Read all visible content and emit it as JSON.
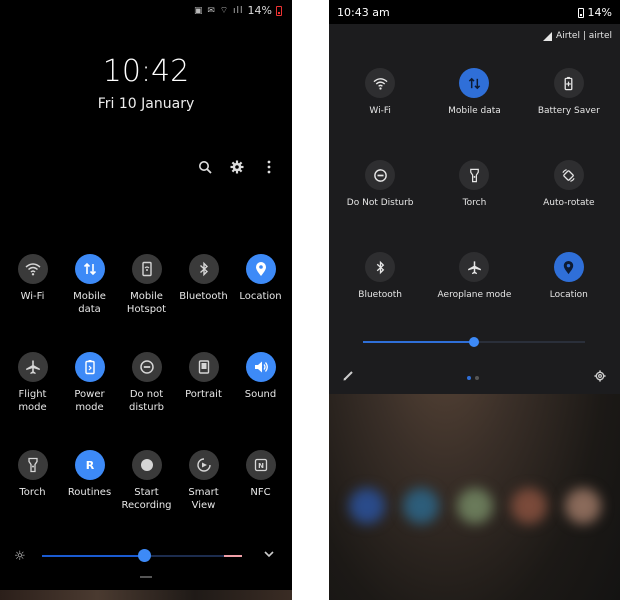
{
  "left": {
    "status": {
      "signal_icons": "▣ ✉ ⌔ ıll",
      "battery": "14%"
    },
    "clock": "10:42",
    "date": "Fri 10 January",
    "tiles": [
      [
        {
          "name": "wifi",
          "icon": "wifi-icon",
          "label": "Wi-Fi",
          "on": false
        },
        {
          "name": "mobile-data",
          "icon": "data-arrows-icon",
          "label": "Mobile\ndata",
          "on": true
        },
        {
          "name": "mobile-hotspot",
          "icon": "hotspot-icon",
          "label": "Mobile\nHotspot",
          "on": false
        },
        {
          "name": "bluetooth",
          "icon": "bluetooth-icon",
          "label": "Bluetooth",
          "on": false
        },
        {
          "name": "location",
          "icon": "location-pin-icon",
          "label": "Location",
          "on": true
        }
      ],
      [
        {
          "name": "flight-mode",
          "icon": "airplane-icon",
          "label": "Flight\nmode",
          "on": false
        },
        {
          "name": "power-mode",
          "icon": "power-mode-icon",
          "label": "Power\nmode",
          "on": true
        },
        {
          "name": "do-not-disturb",
          "icon": "minus-circle-icon",
          "label": "Do not\ndisturb",
          "on": false
        },
        {
          "name": "portrait",
          "icon": "portrait-icon",
          "label": "Portrait",
          "on": false
        },
        {
          "name": "sound",
          "icon": "speaker-icon",
          "label": "Sound",
          "on": true
        }
      ],
      [
        {
          "name": "torch",
          "icon": "torch-icon",
          "label": "Torch",
          "on": false
        },
        {
          "name": "routines",
          "icon": "routines-icon",
          "label": "Routines",
          "on": true
        },
        {
          "name": "start-recording",
          "icon": "record-icon",
          "label": "Start\nRecording",
          "on": false
        },
        {
          "name": "smart-view",
          "icon": "smart-view-icon",
          "label": "Smart\nView",
          "on": false
        },
        {
          "name": "nfc",
          "icon": "nfc-icon",
          "label": "NFC",
          "on": false
        }
      ]
    ],
    "brightness": 0.51,
    "colors": {
      "accent": "#3d8af7",
      "tile_off": "#3a3a3a",
      "background": "#000000"
    }
  },
  "right": {
    "time": "10:43 am",
    "battery": "14%",
    "carrier": "Airtel | airtel",
    "tiles": [
      [
        {
          "name": "wifi",
          "icon": "wifi-icon",
          "label": "Wi-Fi",
          "on": false
        },
        {
          "name": "mobile-data",
          "icon": "data-arrows-icon",
          "label": "Mobile data",
          "on": true
        },
        {
          "name": "battery-saver",
          "icon": "battery-saver-icon",
          "label": "Battery Saver",
          "on": false
        }
      ],
      [
        {
          "name": "do-not-disturb",
          "icon": "minus-circle-icon",
          "label": "Do Not Disturb",
          "on": false
        },
        {
          "name": "torch",
          "icon": "torch-icon",
          "label": "Torch",
          "on": false
        },
        {
          "name": "auto-rotate",
          "icon": "rotate-icon",
          "label": "Auto-rotate",
          "on": false
        }
      ],
      [
        {
          "name": "bluetooth",
          "icon": "bluetooth-icon",
          "label": "Bluetooth",
          "on": false
        },
        {
          "name": "aeroplane-mode",
          "icon": "airplane-icon",
          "label": "Aeroplane mode",
          "on": false
        },
        {
          "name": "location",
          "icon": "location-pin-icon",
          "label": "Location",
          "on": true
        }
      ]
    ],
    "brightness": 0.5,
    "page_dots": 2,
    "colors": {
      "accent": "#2f6fd8",
      "tile_off": "#2e2e30",
      "panel": "#1c1c1e"
    }
  }
}
